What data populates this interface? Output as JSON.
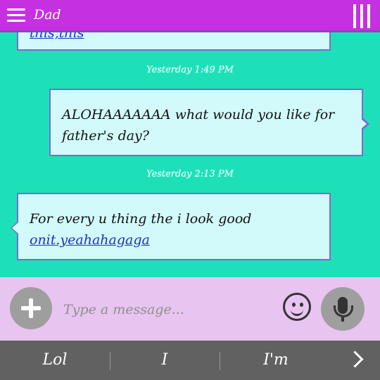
{
  "header": {
    "title": "Dad"
  },
  "messages": [
    {
      "text": "",
      "link": "this,this"
    },
    {
      "timestamp": "Yesterday 1:49 PM",
      "text": "ALOHAAAAAAA what would you like for father's day?"
    },
    {
      "timestamp": "Yesterday 2:13 PM",
      "text": "For every u thing the i look good",
      "link": "onit.yeahahagaga"
    }
  ],
  "composer": {
    "placeholder": "Type a message..."
  },
  "suggestions": [
    "Lol",
    "I",
    "I'm"
  ],
  "colors": {
    "header": "#c531e0",
    "background": "#1de0b8",
    "bubble": "#d2fafa",
    "bubble_border": "#7b69d6",
    "composer": "#e8c4f0",
    "suggest_bar": "#616161"
  },
  "icons": [
    "menu-icon",
    "overflow-icon",
    "add-icon",
    "emoji-icon",
    "mic-icon",
    "chevron-right-icon"
  ]
}
